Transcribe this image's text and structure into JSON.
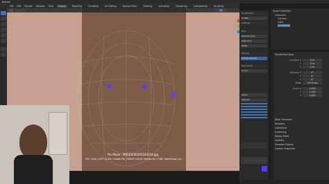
{
  "window": {
    "title": "Blender"
  },
  "menubar": {
    "menus": [
      "File",
      "Edit",
      "Render",
      "Window",
      "Help"
    ],
    "workspaces": [
      "Layout",
      "Modeling",
      "Sculpting",
      "UV Editing",
      "Texture Paint",
      "Shading",
      "Animation",
      "Rendering",
      "Compositing",
      "Scripting"
    ],
    "active_workspace": "Layout"
  },
  "viewport": {
    "tool_line_1": "Pin Mode - IMG20200205183318.jpg",
    "tool_line_2": "ESC: Exit | LEFT CLICK: Create Pin | RIGHT CLICK: Delete Pin | TAB: Hide/Show | H:..."
  },
  "addon": {
    "rows": [
      "FaceBuilder",
      "Create",
      "Settings",
      "Pins",
      "Remove pins",
      "Align face",
      "Reset",
      "Texture",
      "Create texture",
      "Wireframe",
      "Colors",
      "Views",
      "Camera"
    ]
  },
  "outliner": {
    "title": "Scene Collection",
    "items": [
      "Collection",
      "Camera",
      "Light",
      "FaceBuilder"
    ]
  },
  "properties": {
    "object_name": "FaceBuilderHead",
    "field_labels": [
      "Location X",
      "Y",
      "Z",
      "Rotation X",
      "Y",
      "Z",
      "Mode",
      "Scale X",
      "Y",
      "Z"
    ],
    "field_values": [
      "0 m",
      "0 m",
      "0 m",
      "0°",
      "0°",
      "0°",
      "XYZ Euler",
      "1.000",
      "1.000",
      "1.000"
    ],
    "sections": [
      "Delta Transform",
      "Relations",
      "Collections",
      "Instancing",
      "Motion Paths",
      "Visibility",
      "Viewport Display",
      "Custom Properties"
    ]
  },
  "colors": {
    "accent": "#4772b3",
    "active_pin": "#5a3aff",
    "mesh": "#d8d0c8"
  }
}
